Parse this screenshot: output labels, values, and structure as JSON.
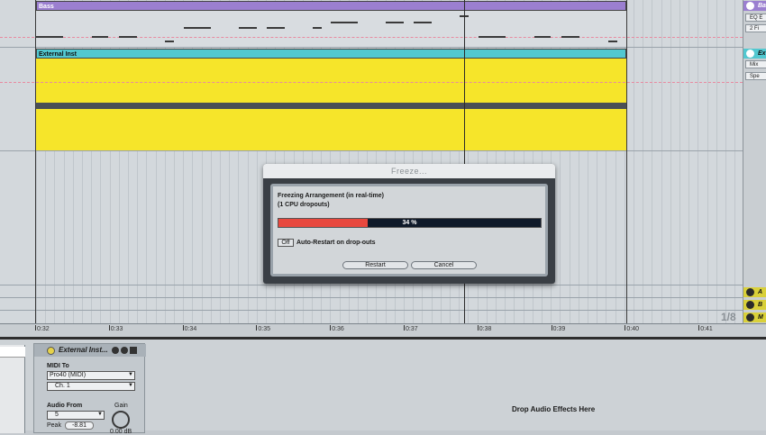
{
  "tracks": {
    "bass_clip_name": "Bass",
    "ext_clip_name": "External Inst"
  },
  "right_panel": {
    "bass_label": "Ba",
    "bass_btn1": "EQ E",
    "bass_btn2": "2 Fi",
    "ext_label": "Ex",
    "ext_btn1": "Mix",
    "ext_btn2": "Spe",
    "return_a": "A",
    "return_b": "B",
    "master": "M",
    "quantize": "1/8"
  },
  "ruler": {
    "ticks": [
      "0:32",
      "0:33",
      "0:34",
      "0:35",
      "0:36",
      "0:37",
      "0:38",
      "0:39",
      "0:40",
      "0:41"
    ]
  },
  "dialog": {
    "title": "Freeze...",
    "status_line1": "Freezing Arrangement (in real-time)",
    "status_line2": "(1 CPU dropouts)",
    "progress": 0.34,
    "progress_text": "34 %",
    "toggle_label": "Off",
    "auto_restart_label": "Auto-Restart on drop-outs",
    "restart_label": "Restart",
    "cancel_label": "Cancel"
  },
  "device": {
    "title": "External Inst...",
    "midi_to_label": "MIDI To",
    "midi_to_value": "Pro40 (MIDI)",
    "midi_channel": "Ch. 1",
    "audio_from_label": "Audio From",
    "audio_from_value": "5",
    "gain_label": "Gain",
    "peak_label": "Peak",
    "peak_value": "-8.81",
    "gain_value": "0.00 dB"
  },
  "drop_zone": "Drop Audio Effects Here",
  "colors": {
    "bass_clip": "#9b7fd0",
    "ext_clip": "#52c8d0",
    "audio_fill": "#f6e52a",
    "progress_fill": "#e8483e"
  }
}
